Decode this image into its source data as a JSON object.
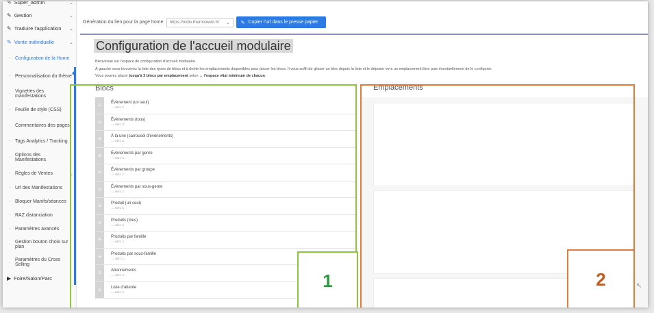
{
  "sidebar": {
    "items": [
      {
        "label": "Super_admin",
        "type": "top",
        "icon": "wrench-icon"
      },
      {
        "label": "Gestion",
        "type": "top",
        "icon": "wrench-icon"
      },
      {
        "label": "Traduire l'application",
        "type": "top",
        "icon": "wrench-icon"
      },
      {
        "label": "Vente individuelle",
        "type": "top-active",
        "icon": "wrench-icon"
      },
      {
        "label": "Configuration de la Home",
        "type": "current"
      },
      {
        "label": "Personnalisation du thème",
        "type": "sub"
      },
      {
        "label": "Vignettes des manifestations",
        "type": "sub"
      },
      {
        "label": "Feuille de style (CSS)",
        "type": "sub"
      },
      {
        "label": "Commentaires des pages",
        "type": "sub"
      },
      {
        "label": "Tags Analytics / Tracking",
        "type": "sub"
      },
      {
        "label": "Options des Manifestations",
        "type": "sub"
      },
      {
        "label": "Règles de Ventes",
        "type": "sub-chev"
      },
      {
        "label": "Url des Manifestations",
        "type": "sub"
      },
      {
        "label": "Bloquer Manifs/séances",
        "type": "sub"
      },
      {
        "label": "RAZ distanciation",
        "type": "sub"
      },
      {
        "label": "Paramètres avancés",
        "type": "sub"
      },
      {
        "label": "Gestion bouton choix sur plan",
        "type": "sub"
      },
      {
        "label": "Paramètres du Cross Selling",
        "type": "sub"
      },
      {
        "label": "Foire/Salon/Parc",
        "type": "top",
        "icon": "flag-icon"
      }
    ]
  },
  "topbar": {
    "label": "Génération du lien pour la page home",
    "url_value": "https://indiv.themisweb.fr/",
    "copy_button": "Copier l'url dans le presse papier"
  },
  "header": {
    "title": "Configuration de l'accueil modulaire",
    "intro_1": "Bienvenue sur l'espace de configuration d'accueil modulaire.",
    "intro_2": "À gauche vous trouverez la liste des types de blocs et à droite les emplacements disponibles pour placer les blocs. Il vous suffit de glisser un bloc depuis la liste et le déposer vers un emplacement libre puis éventuellement de le configurer.",
    "intro_3a": "Vous pouvez placer ",
    "intro_3b": "jusqu'à 3 blocs par emplacement",
    "intro_3c": " selon ",
    "intro_3d": "↔ l'espace vital minimum de chacun",
    "intro_3e": "."
  },
  "blocs": {
    "title": "Blocs",
    "items": [
      {
        "name": "Évènement (un seul)",
        "min": "↔ min: 1"
      },
      {
        "name": "Évènements (tous)",
        "min": "↔ min: 2"
      },
      {
        "name": "À la une (carrousel d'évènements)",
        "min": "↔ min: 2"
      },
      {
        "name": "Évènements par genre",
        "min": "↔ min: 1"
      },
      {
        "name": "Évènements par groupe",
        "min": "↔ min: 1"
      },
      {
        "name": "Évènements par sous-genre",
        "min": "↔ min: 1"
      },
      {
        "name": "Produit (un seul)",
        "min": "↔ min: 1"
      },
      {
        "name": "Produits (tous)",
        "min": "↔ min: 1"
      },
      {
        "name": "Produits par famille",
        "min": "↔ min: 1"
      },
      {
        "name": "Produits par sous-famille",
        "min": "↔ min: 1"
      },
      {
        "name": "Abonnements",
        "min": "↔ min: 1"
      },
      {
        "name": "Liste d'attente",
        "min": "↔ min: 1"
      }
    ]
  },
  "emplacements": {
    "title": "Emplacements"
  },
  "annotations": {
    "box1": {
      "label": "1",
      "color": "#8cc63f",
      "text_color": "#2e9a3e"
    },
    "box2": {
      "label": "2",
      "color": "#e07b39",
      "text_color": "#c05a1e"
    }
  },
  "colors": {
    "accent": "#2c7be5"
  }
}
